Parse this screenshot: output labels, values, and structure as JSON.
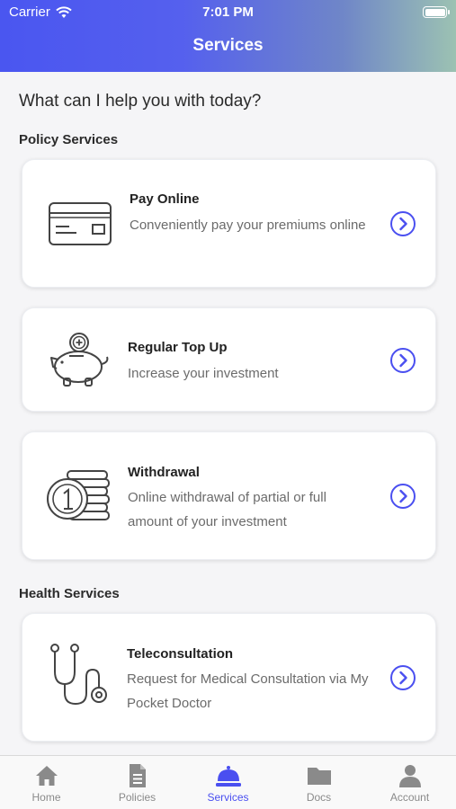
{
  "status_bar": {
    "carrier": "Carrier",
    "time": "7:01 PM"
  },
  "header": {
    "title": "Services"
  },
  "greeting": "What can I help you with today?",
  "sections": [
    {
      "title": "Policy Services",
      "cards": [
        {
          "title": "Pay Online",
          "description": "Conveniently pay your premiums online",
          "icon": "credit-card-icon"
        },
        {
          "title": "Regular Top Up",
          "description": "Increase your investment",
          "icon": "piggy-bank-icon"
        },
        {
          "title": "Withdrawal",
          "description": "Online withdrawal of partial or full amount of your investment",
          "icon": "coin-stack-icon"
        }
      ]
    },
    {
      "title": "Health Services",
      "cards": [
        {
          "title": "Teleconsultation",
          "description": "Request for Medical Consultation via My Pocket Doctor",
          "icon": "stethoscope-icon"
        }
      ]
    }
  ],
  "tabs": [
    {
      "label": "Home",
      "icon": "home-icon"
    },
    {
      "label": "Policies",
      "icon": "document-icon"
    },
    {
      "label": "Services",
      "icon": "service-bell-icon",
      "active": true
    },
    {
      "label": "Docs",
      "icon": "folder-icon"
    },
    {
      "label": "Account",
      "icon": "person-icon"
    }
  ],
  "colors": {
    "accent": "#4a4ff0",
    "header_start": "#4a56f0",
    "header_end": "#9cc2b2",
    "inactive_tab": "#8a8a8a"
  }
}
